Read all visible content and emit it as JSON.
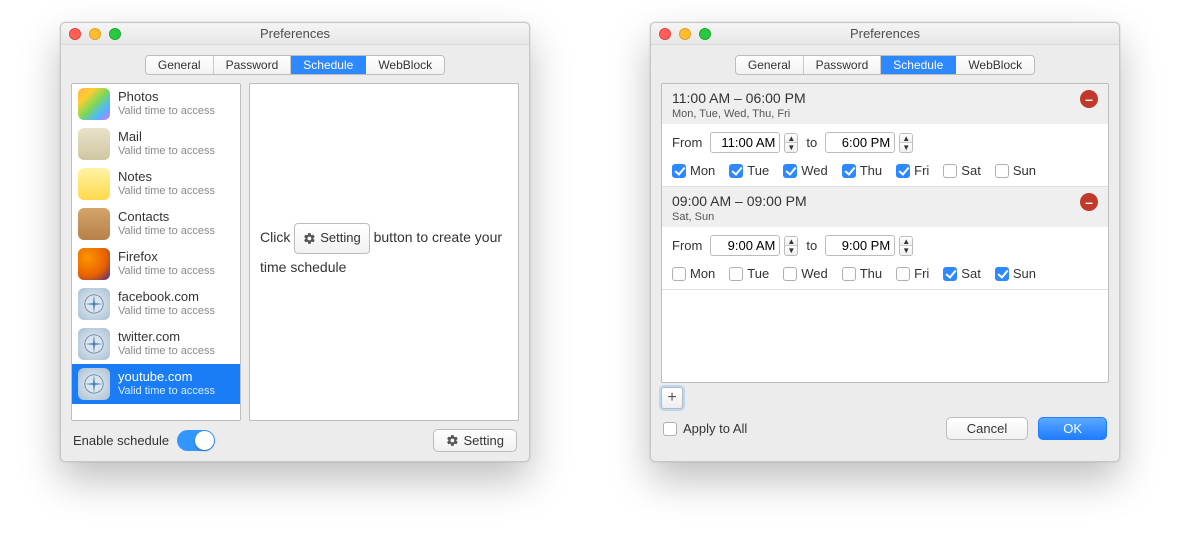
{
  "title": "Preferences",
  "tabs": [
    "General",
    "Password",
    "Schedule",
    "WebBlock"
  ],
  "active_tab_index": 2,
  "left": {
    "items": [
      {
        "name": "Photos",
        "sub": "Valid time to access",
        "icon": "photos",
        "bg": "linear-gradient(135deg,#ffb347,#ffcc33,#7ed957,#4db8ff,#d870f3)"
      },
      {
        "name": "Mail",
        "sub": "Valid time to access",
        "icon": "mail",
        "bg": "linear-gradient(#e9e2c9,#cfc6a3)"
      },
      {
        "name": "Notes",
        "sub": "Valid time to access",
        "icon": "notes",
        "bg": "linear-gradient(#fff3a6,#ffd94a)"
      },
      {
        "name": "Contacts",
        "sub": "Valid time to access",
        "icon": "contacts",
        "bg": "linear-gradient(#d4a46a,#b6814a)"
      },
      {
        "name": "Firefox",
        "sub": "Valid time to access",
        "icon": "firefox",
        "bg": "radial-gradient(circle at 30% 30%, #ff9500, #e66000 60%, #4a2b88)"
      },
      {
        "name": "facebook.com",
        "sub": "Valid time to access",
        "icon": "safari",
        "bg": "radial-gradient(circle,#e8f0f6,#a9bfd2)"
      },
      {
        "name": "twitter.com",
        "sub": "Valid time to access",
        "icon": "safari",
        "bg": "radial-gradient(circle,#e8f0f6,#a9bfd2)"
      },
      {
        "name": "youtube.com",
        "sub": "Valid time to access",
        "icon": "safari",
        "bg": "radial-gradient(circle,#e8f0f6,#a9bfd2)",
        "selected": true
      }
    ],
    "placeholder_pre": "Click",
    "placeholder_post": "button to create your time schedule",
    "setting_label": "Setting",
    "enable_label": "Enable schedule",
    "setting_btn": "Setting"
  },
  "right": {
    "schedules": [
      {
        "summary_time": "11:00 AM  –  06:00 PM",
        "summary_days": "Mon, Tue, Wed, Thu, Fri",
        "from_label": "From",
        "to_label": "to",
        "from": "11:00 AM",
        "to": "6:00 PM",
        "days": {
          "Mon": true,
          "Tue": true,
          "Wed": true,
          "Thu": true,
          "Fri": true,
          "Sat": false,
          "Sun": false
        }
      },
      {
        "summary_time": "09:00 AM  –  09:00 PM",
        "summary_days": "Sat, Sun",
        "from_label": "From",
        "to_label": "to",
        "from": "9:00 AM",
        "to": "9:00 PM",
        "days": {
          "Mon": false,
          "Tue": false,
          "Wed": false,
          "Thu": false,
          "Fri": false,
          "Sat": true,
          "Sun": true
        }
      }
    ],
    "apply_all": "Apply to All",
    "cancel": "Cancel",
    "ok": "OK"
  }
}
